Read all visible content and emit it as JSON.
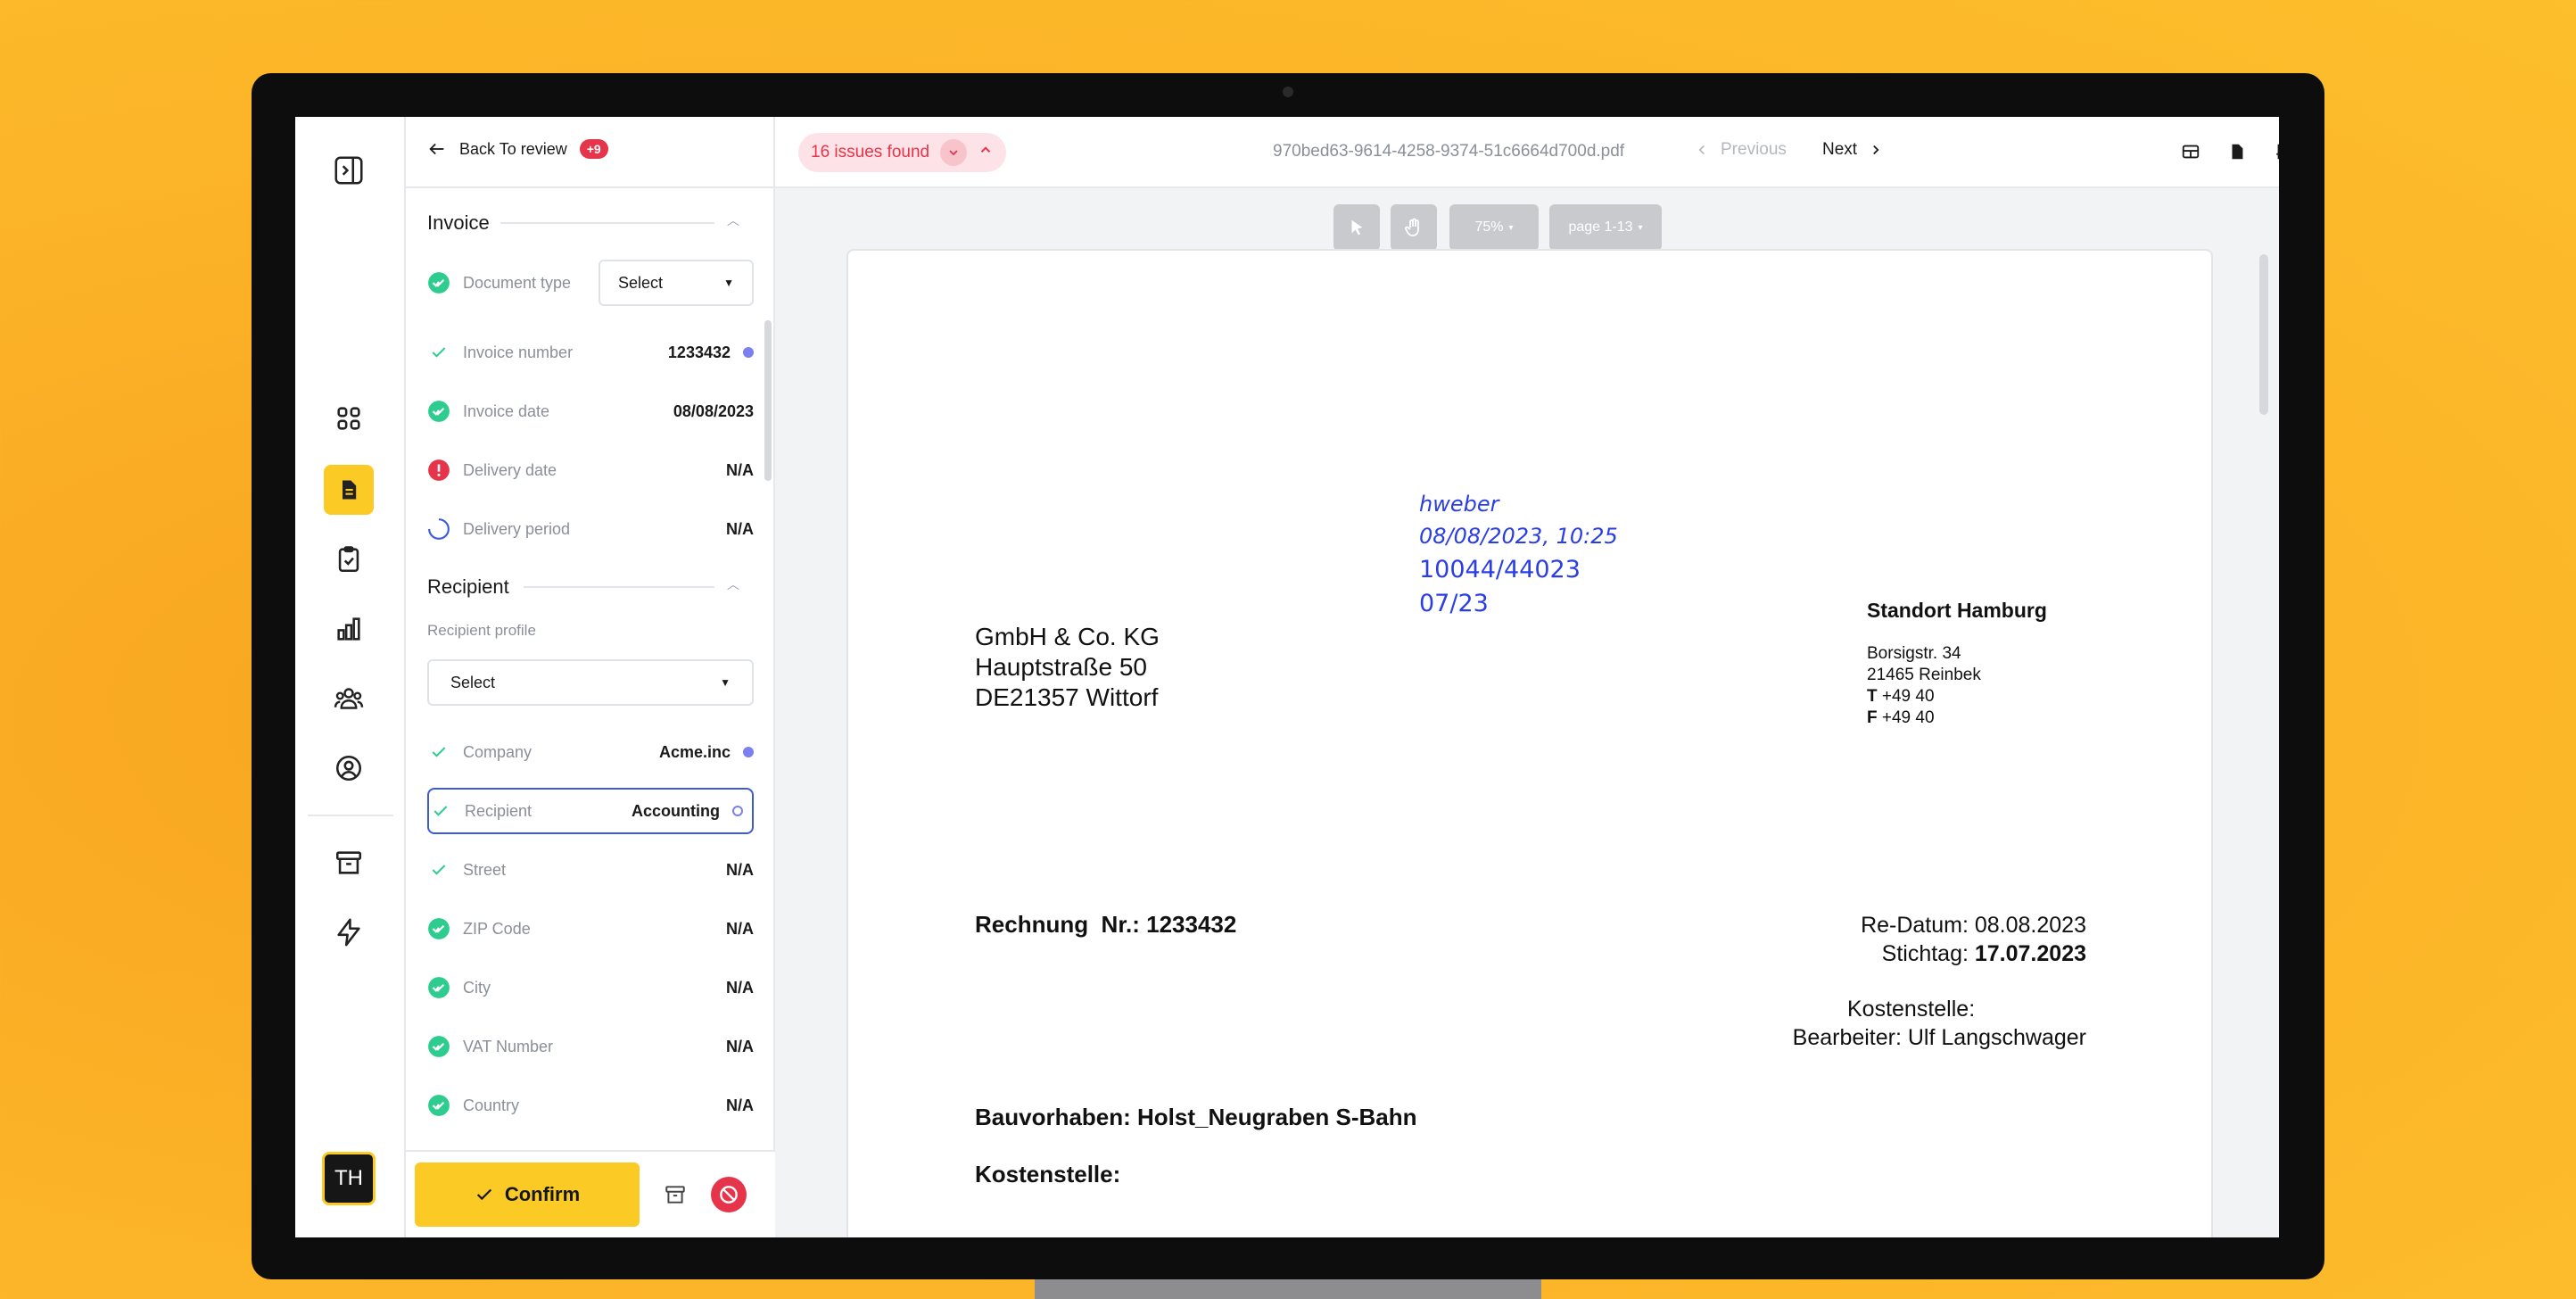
{
  "rail": {
    "avatar_initials": "TH",
    "items": [
      "collapse-sidebar",
      "dashboard",
      "documents",
      "tasks",
      "analytics",
      "team",
      "profile",
      "archive",
      "automations"
    ]
  },
  "panel": {
    "back_label": "Back To review",
    "back_badge": "+9",
    "invoice_section": "Invoice",
    "fields_invoice": [
      {
        "label": "Document type",
        "value": "Select",
        "status": "verified"
      },
      {
        "label": "Invoice number",
        "value": "1233432",
        "status": "checked"
      },
      {
        "label": "Invoice date",
        "value": "08/08/2023",
        "status": "verified"
      },
      {
        "label": "Delivery date",
        "value": "N/A",
        "status": "error"
      },
      {
        "label": "Delivery period",
        "value": "N/A",
        "status": "loading"
      }
    ],
    "recipient_section": "Recipient",
    "recipient_profile_label": "Recipient profile",
    "recipient_profile_value": "Select",
    "fields_recipient": [
      {
        "label": "Company",
        "value": "Acme.inc",
        "status": "checked"
      },
      {
        "label": "Recipient",
        "value": "Accounting",
        "status": "checked"
      },
      {
        "label": "Street",
        "value": "N/A",
        "status": "checked"
      },
      {
        "label": "ZIP Code",
        "value": "N/A",
        "status": "verified"
      },
      {
        "label": "City",
        "value": "N/A",
        "status": "verified"
      },
      {
        "label": "VAT Number",
        "value": "N/A",
        "status": "verified"
      },
      {
        "label": "Country",
        "value": "N/A",
        "status": "verified"
      }
    ],
    "confirm_label": "Confirm"
  },
  "topbar": {
    "issues_label": "16 issues found",
    "filename": "970bed63-9614-4258-9374-51c6664d700d.pdf",
    "previous_label": "Previous",
    "next_label": "Next"
  },
  "viewer": {
    "zoom": "75%",
    "page_range": "page 1-13"
  },
  "document": {
    "stamp_user": "hweber",
    "stamp_datetime": "08/08/2023, 10:25",
    "stamp_ref": "10044/44023",
    "stamp_period": "07/23",
    "sender_lines": [
      "GmbH & Co. KG",
      "Hauptstraße 50",
      "DE21357 Wittorf"
    ],
    "location_title": "Standort Hamburg",
    "location_street": "Borsigstr. 34",
    "location_city": "21465 Reinbek",
    "phone_prefix": "T",
    "phone": "+49 40",
    "fax_prefix": "F",
    "fax": "+49 40",
    "invoice_heading": "Rechnung  Nr.: 1233432",
    "re_datum": "Re-Datum: 08.08.2023",
    "stichtag_label": "Stichtag:",
    "stichtag_value": "17.07.2023",
    "kostenstelle_right": "Kostenstelle:",
    "bearbeiter": "Bearbeiter: Ulf Langschwager",
    "bauvorhaben": "Bauvorhaben: Holst_Neugraben S-Bahn",
    "kostenstelle_left": "Kostenstelle:"
  },
  "colors": {
    "accent": "#fbca24",
    "danger": "#e6344a",
    "success": "#2ecc8f",
    "stamp_blue": "#2b3ee6",
    "info_dot": "#7b7ff0"
  }
}
